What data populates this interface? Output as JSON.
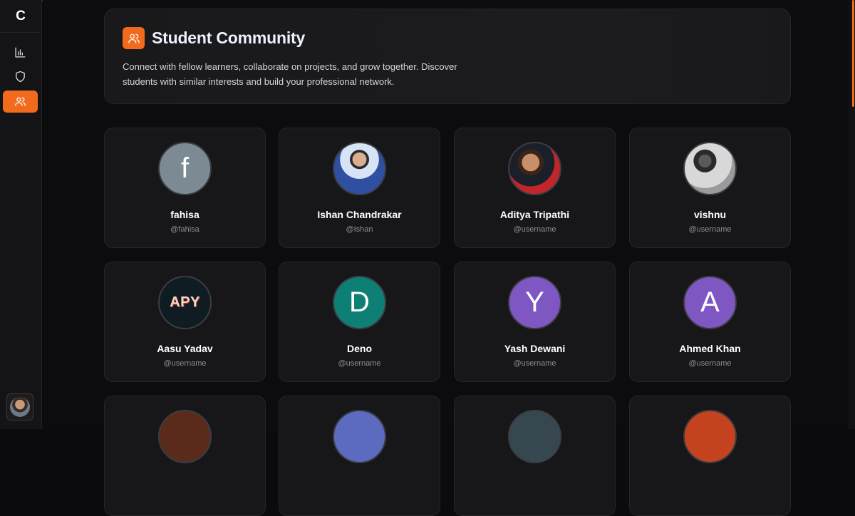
{
  "sidebar": {
    "brand": "C",
    "items": [
      {
        "name": "analytics",
        "icon": "bar-chart-icon"
      },
      {
        "name": "security",
        "icon": "shield-icon"
      },
      {
        "name": "community",
        "icon": "users-icon",
        "active": true
      }
    ],
    "expand_icon": "›"
  },
  "hero": {
    "title": "Student Community",
    "description": "Connect with fellow learners, collaborate on projects, and grow together. Discover students with similar interests and build your professional network."
  },
  "students": [
    {
      "initial": "f",
      "name": "fahisa",
      "handle": "@fahisa",
      "avatar_color": "#7b8a93"
    },
    {
      "initial": "",
      "name": "Ishan Chandrakar",
      "handle": "@Ishan",
      "avatar_color": "#3c5aa8",
      "photo": true
    },
    {
      "initial": "",
      "name": "Aditya Tripathi",
      "handle": "@username",
      "avatar_color": "#b02a2a",
      "photo": true
    },
    {
      "initial": "",
      "name": "vishnu",
      "handle": "@username",
      "avatar_color": "#8a8a8a",
      "photo": true
    },
    {
      "initial": "APY",
      "name": "Aasu Yadav",
      "handle": "@username",
      "avatar_color": "#0f1d22"
    },
    {
      "initial": "D",
      "name": "Deno",
      "handle": "@username",
      "avatar_color": "#0d7f74"
    },
    {
      "initial": "Y",
      "name": "Yash Dewani",
      "handle": "@username",
      "avatar_color": "#7e57c2"
    },
    {
      "initial": "A",
      "name": "Ahmed Khan",
      "handle": "@username",
      "avatar_color": "#7e57c2"
    }
  ],
  "partial_row": [
    {
      "avatar_color": "#5a2b1a"
    },
    {
      "avatar_color": "#5c6bc0"
    },
    {
      "avatar_color": "#37474f"
    },
    {
      "avatar_color": "#c5421f"
    }
  ],
  "colors": {
    "accent": "#f26b1d",
    "card": "#17171a",
    "background": "#0c0c0e"
  }
}
